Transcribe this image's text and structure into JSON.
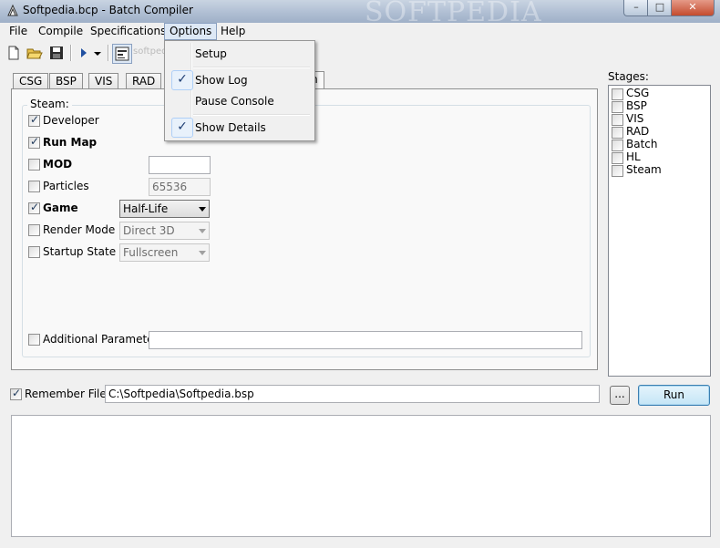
{
  "window": {
    "title": "Softpedia.bcp - Batch Compiler",
    "watermark": "SOFTPEDIA",
    "controls": {
      "minimize": "–",
      "maximize": "□",
      "close": "✕"
    }
  },
  "menubar": {
    "file": "File",
    "compile": "Compile",
    "specifications": "Specifications",
    "options": "Options",
    "help": "Help"
  },
  "toolbar": {
    "watermark": "softpedia.com"
  },
  "options_menu": {
    "setup": "Setup",
    "show_log": "Show Log",
    "show_log_checked": true,
    "pause_console": "Pause Console",
    "show_details": "Show Details",
    "show_details_checked": true,
    "check_glyph": "✓"
  },
  "tabs": [
    "CSG",
    "BSP",
    "VIS",
    "RAD",
    "Steam"
  ],
  "steam": {
    "group_label": "Steam:",
    "developer": {
      "label": "Developer",
      "checked": true
    },
    "run_map": {
      "label": "Run Map",
      "checked": true
    },
    "mod": {
      "label": "MOD",
      "checked": false,
      "value": ""
    },
    "particles": {
      "label": "Particles",
      "checked": false,
      "value": "65536"
    },
    "game": {
      "label": "Game",
      "checked": true,
      "value": "Half-Life"
    },
    "render_mode": {
      "label": "Render Mode",
      "checked": false,
      "value": "Direct 3D"
    },
    "startup_state": {
      "label": "Startup State",
      "checked": false,
      "value": "Fullscreen"
    },
    "additional_parameters": {
      "label": "Additional Parameters",
      "checked": false,
      "value": ""
    }
  },
  "stages": {
    "label": "Stages:",
    "items": [
      "CSG",
      "BSP",
      "VIS",
      "RAD",
      "Batch",
      "HL",
      "Steam"
    ]
  },
  "bottom": {
    "remember_file": {
      "label": "Remember File",
      "checked": true
    },
    "path": "C:\\Softpedia\\Softpedia.bsp",
    "browse_label": "...",
    "run_label": "Run"
  },
  "log": {
    "text": ""
  }
}
